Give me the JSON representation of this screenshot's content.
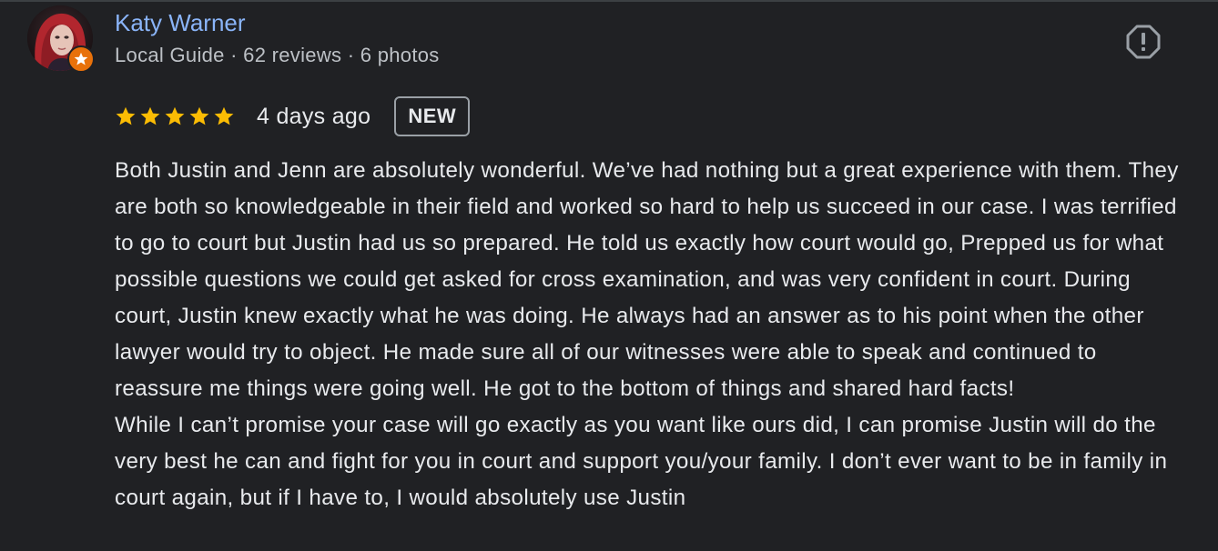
{
  "reviewer": {
    "name": "Katy Warner",
    "meta": "Local Guide · 62 reviews · 6 photos",
    "avatar_icon": "profile-photo",
    "badge_icon": "local-guide-star-icon"
  },
  "report_icon": "report-exclamation-icon",
  "review": {
    "rating": 5,
    "rating_max": 5,
    "time_ago": "4 days ago",
    "badge": "NEW",
    "paragraph_1": "Both Justin and Jenn are absolutely wonderful. We’ve had nothing but a great experience with them. They are both so knowledgeable in their field and worked so hard to help us succeed in our case. I was terrified to go to court but Justin had us so prepared. He told us exactly how court would go, Prepped us for what possible questions we could get asked for cross examination, and was very confident in court. During court, Justin knew exactly what he was doing. He always had an answer as to his point when the other lawyer would try to object. He made sure all of our witnesses were able to speak and continued to reassure me things were going well. He got to the bottom of things and shared hard facts!",
    "paragraph_2": "While I can’t promise your case will go exactly as you want like ours did, I can promise Justin will do the very best he can and fight for you in court and support you/your family. I don’t ever want to be in family in court again, but if I have to, I would absolutely use Justin"
  },
  "colors": {
    "background": "#202124",
    "name_link": "#8ab4f8",
    "star": "#fbbc04",
    "guide_badge": "#e8710a",
    "text": "#e8eaed",
    "secondary_text": "#bdc1c6"
  }
}
